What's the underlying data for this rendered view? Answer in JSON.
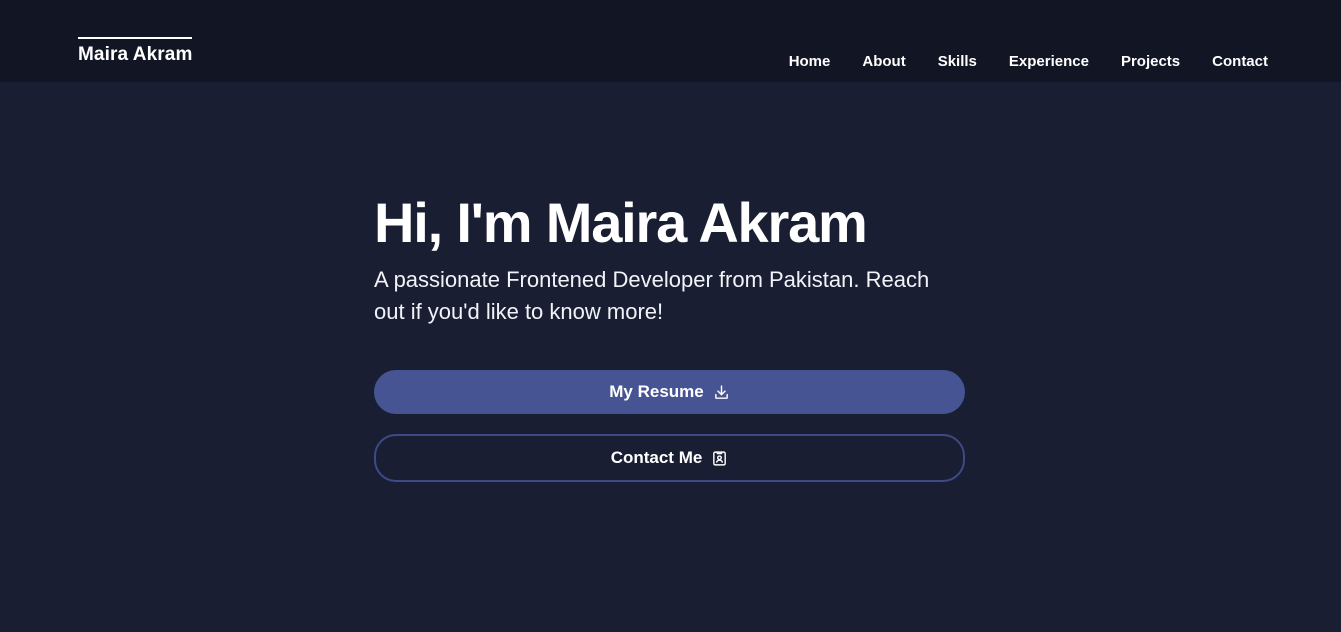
{
  "nav": {
    "brand": "Maira Akram",
    "links": [
      "Home",
      "About",
      "Skills",
      "Experience",
      "Projects",
      "Contact"
    ]
  },
  "hero": {
    "title": "Hi, I'm Maira Akram",
    "subtitle": "A passionate Frontened Developer from Pakistan. Reach out if you'd like to know more!"
  },
  "buttons": {
    "resume": {
      "label": "My Resume",
      "icon": "download-icon"
    },
    "contact": {
      "label": "Contact Me",
      "icon": "contact-card-icon"
    }
  },
  "colors": {
    "background": "#191e33",
    "navbar": "#111524",
    "primary_button": "#465494",
    "outline_border": "#3c4a86",
    "text": "#ffffff"
  }
}
